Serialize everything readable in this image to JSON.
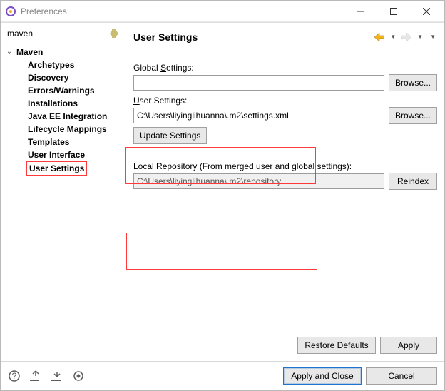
{
  "window": {
    "title": "Preferences"
  },
  "filter": {
    "value": "maven"
  },
  "tree": {
    "root_label": "Maven",
    "children": [
      {
        "label": "Archetypes"
      },
      {
        "label": "Discovery"
      },
      {
        "label": "Errors/Warnings"
      },
      {
        "label": "Installations"
      },
      {
        "label": "Java EE Integration"
      },
      {
        "label": "Lifecycle Mappings"
      },
      {
        "label": "Templates"
      },
      {
        "label": "User Interface"
      },
      {
        "label": "User Settings"
      }
    ],
    "selected": "User Settings"
  },
  "page": {
    "heading": "User Settings",
    "global_settings_label_pre": "Global ",
    "global_settings_label_u": "S",
    "global_settings_label_post": "ettings:",
    "global_settings_value": "",
    "browse1": "Browse...",
    "user_settings_label_pre": "",
    "user_settings_label_u": "U",
    "user_settings_label_post": "ser Settings:",
    "user_settings_value": "C:\\Users\\liyinglihuanna\\.m2\\settings.xml",
    "browse2": "Browse...",
    "update_settings": "Update Settings",
    "local_repo_label": "Local Repository (From merged user and global settings):",
    "local_repo_value": "C:\\Users\\liyinglihuanna\\.m2\\repository",
    "reindex": "Reindex",
    "restore_defaults": "Restore Defaults",
    "apply": "Apply",
    "apply_close": "Apply and Close",
    "cancel": "Cancel"
  }
}
